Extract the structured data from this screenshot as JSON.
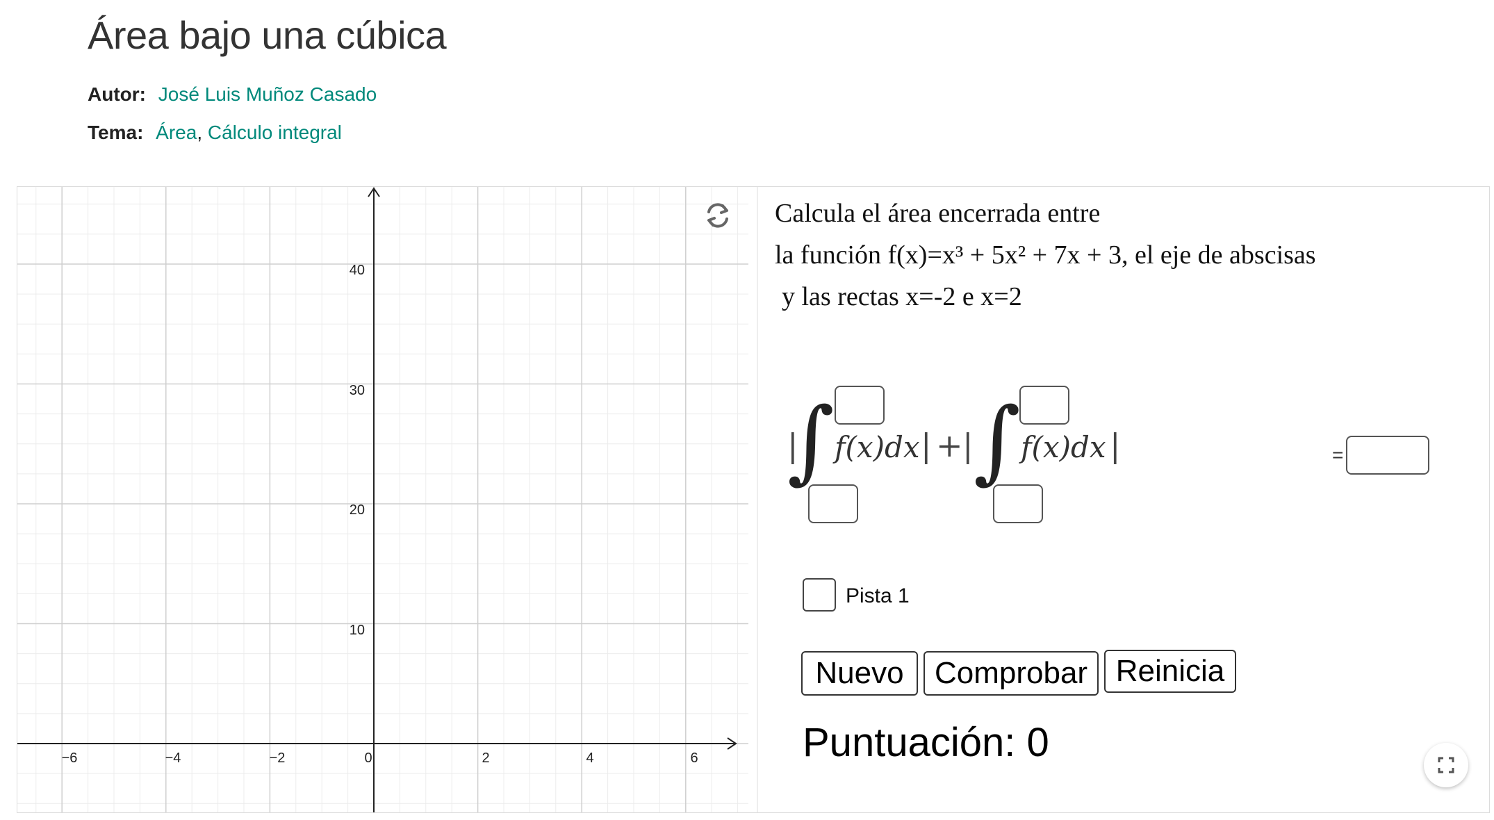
{
  "header": {
    "title": "Área bajo una cúbica",
    "author_label": "Autor:",
    "author_name": "José Luis Muñoz Casado",
    "topic_label": "Tema:",
    "topics": [
      "Área",
      "Cálculo integral"
    ],
    "topic_separator": ","
  },
  "colors": {
    "link": "#00897b",
    "grid_major": "#cfcfcf",
    "grid_minor": "#ececec",
    "axis": "#222222"
  },
  "graph": {
    "x_ticks": [
      "−6",
      "−4",
      "−2",
      "0",
      "2",
      "4",
      "6"
    ],
    "y_ticks": [
      "10",
      "20",
      "30",
      "40"
    ]
  },
  "problem": {
    "line1": "Calcula el área encerrada entre",
    "line2": "la función f(x)=x³ + 5x² + 7x + 3, el eje de abscisas",
    "line3": "y las rectas x=-2 e x=2"
  },
  "formula": {
    "bar": "|",
    "integrand": "f(x)dx",
    "plus": "+",
    "equals": "="
  },
  "hint": {
    "label": "Pista 1"
  },
  "buttons": {
    "new": "Nuevo",
    "check": "Comprobar",
    "reset": "Reinicia"
  },
  "score": {
    "text": "Puntuación: 0"
  },
  "icons": {
    "reset": "refresh-icon",
    "fullscreen": "fullscreen-icon"
  }
}
